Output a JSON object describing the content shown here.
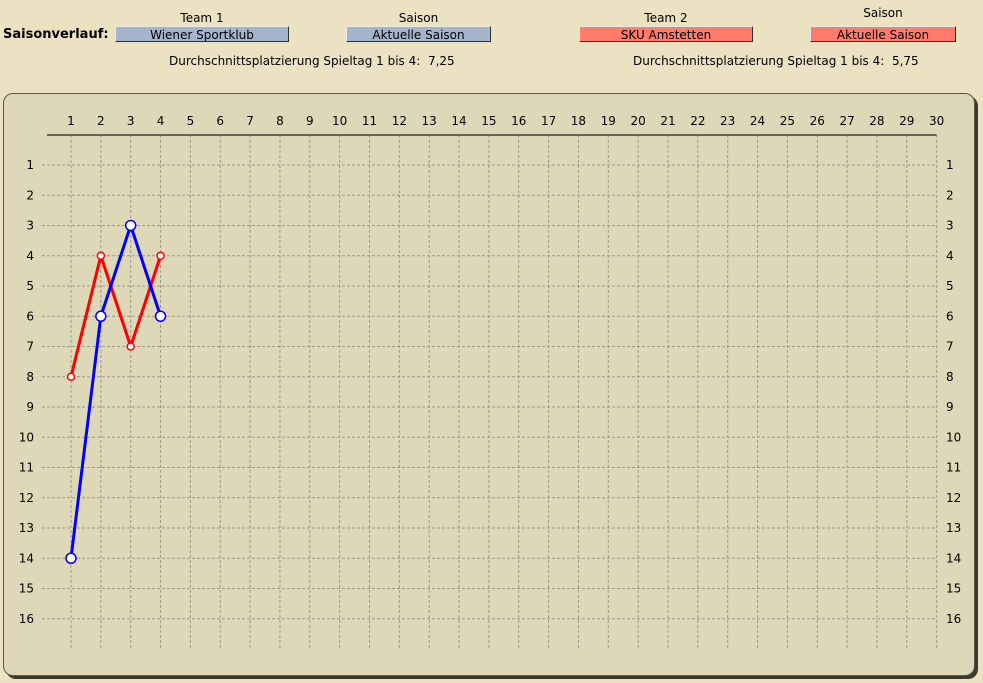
{
  "header": {
    "title": "Saisonverlauf:",
    "team1_caption": "Team 1",
    "season1_caption": "Saison",
    "team2_caption": "Team 2",
    "season2_caption": "Saison",
    "team1_value": "Wiener Sportklub",
    "season1_value": "Aktuelle Saison",
    "team2_value": "SKU Amstetten",
    "season2_value": "Aktuelle Saison",
    "avg1_label": "Durchschnittsplatzierung Spieltag 1 bis 4:",
    "avg1_value": "7,25",
    "avg2_label": "Durchschnittsplatzierung Spieltag 1 bis 4:",
    "avg2_value": "5,75"
  },
  "colors": {
    "team1_selector": "#a3b5cb",
    "team2_selector": "#ff7b6b",
    "series1": "#0000ff",
    "series2": "#ff0000",
    "grid": "#9a9a88"
  },
  "chart_data": {
    "type": "line",
    "x": [
      1,
      2,
      3,
      4
    ],
    "xlim": [
      1,
      30
    ],
    "ylim": [
      1,
      16
    ],
    "y_inverted": true,
    "x_ticks": [
      1,
      2,
      3,
      4,
      5,
      6,
      7,
      8,
      9,
      10,
      11,
      12,
      13,
      14,
      15,
      16,
      17,
      18,
      19,
      20,
      21,
      22,
      23,
      24,
      25,
      26,
      27,
      28,
      29,
      30
    ],
    "y_ticks": [
      1,
      2,
      3,
      4,
      5,
      6,
      7,
      8,
      9,
      10,
      11,
      12,
      13,
      14,
      15,
      16
    ],
    "grid": true,
    "series": [
      {
        "name": "Wiener Sportklub",
        "values": [
          14,
          6,
          3,
          6
        ]
      },
      {
        "name": "SKU Amstetten",
        "values": [
          8,
          4,
          7,
          4
        ]
      }
    ]
  }
}
